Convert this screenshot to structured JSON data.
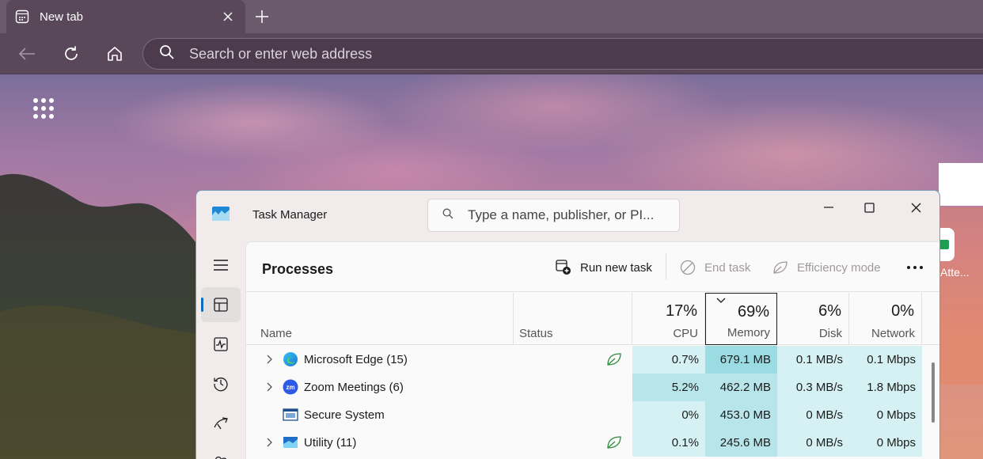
{
  "browser": {
    "tab_title": "New tab",
    "address_placeholder": "Search or enter web address"
  },
  "newtab": {
    "tile_label": "Atte..."
  },
  "task_manager": {
    "title": "Task Manager",
    "search_placeholder": "Type a name, publisher, or PI...",
    "page_title": "Processes",
    "actions": {
      "run_new_task": "Run new task",
      "end_task": "End task",
      "efficiency_mode": "Efficiency mode"
    },
    "columns": {
      "name": "Name",
      "status": "Status",
      "cpu": {
        "percent": "17%",
        "label": "CPU"
      },
      "memory": {
        "percent": "69%",
        "label": "Memory"
      },
      "disk": {
        "percent": "6%",
        "label": "Disk"
      },
      "network": {
        "percent": "0%",
        "label": "Network"
      }
    },
    "rows": [
      {
        "name": "Microsoft Edge (15)",
        "cpu": "0.7%",
        "memory": "679.1 MB",
        "disk": "0.1 MB/s",
        "network": "0.1 Mbps",
        "icon": "edge-icon",
        "efficiency": true,
        "expandable": true
      },
      {
        "name": "Zoom Meetings (6)",
        "cpu": "5.2%",
        "memory": "462.2 MB",
        "disk": "0.3 MB/s",
        "network": "1.8 Mbps",
        "icon": "zoom-icon",
        "efficiency": false,
        "expandable": true
      },
      {
        "name": "Secure System",
        "cpu": "0%",
        "memory": "453.0 MB",
        "disk": "0 MB/s",
        "network": "0 Mbps",
        "icon": "secure-system-icon",
        "efficiency": false,
        "expandable": false
      },
      {
        "name": "Utility (11)",
        "cpu": "0.1%",
        "memory": "245.6 MB",
        "disk": "0 MB/s",
        "network": "0 Mbps",
        "icon": "utility-icon",
        "efficiency": true,
        "expandable": true
      }
    ],
    "colors": {
      "heat_light": "#d6f1f3",
      "heat_medium": "#b7e5ea",
      "heat_strong": "#9bdbe2",
      "accent": "#0f6cbd"
    }
  }
}
